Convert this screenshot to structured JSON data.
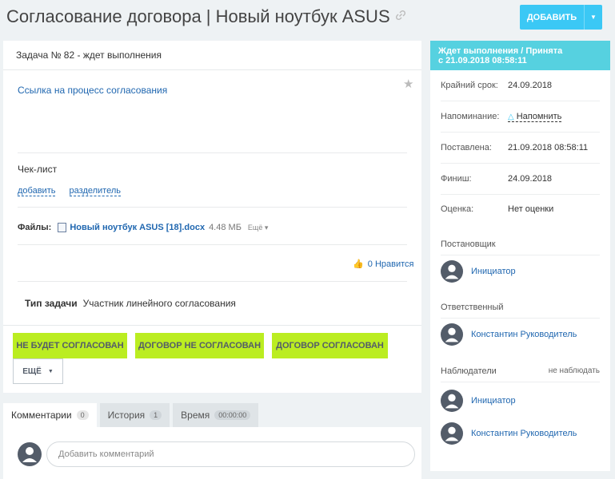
{
  "header": {
    "title": "Согласование договора | Новый ноутбук ASUS",
    "add_label": "ДОБАВИТЬ"
  },
  "task": {
    "heading": "Задача № 82 - ждет выполнения",
    "process_link": "Ссылка на процесс согласования",
    "checklist_label": "Чек-лист",
    "checklist_add": "добавить",
    "checklist_separator": "разделитель",
    "files_label": "Файлы:",
    "file_name": "Новый ноутбук ASUS [18].docx",
    "file_size": "4.48 МБ",
    "file_more": "Ещё",
    "like_count": "0",
    "like_label": "Нравится",
    "type_label": "Тип задачи",
    "type_value": "Участник линейного согласования"
  },
  "actions": {
    "not_approved": "НЕ БУДЕТ СОГЛАСОВАН",
    "contract_rejected": "ДОГОВОР НЕ СОГЛАСОВАН",
    "contract_approved": "ДОГОВОР СОГЛАСОВАН",
    "more": "ЕЩЁ"
  },
  "tabs": [
    {
      "label": "Комментарии",
      "count": "0"
    },
    {
      "label": "История",
      "count": "1"
    },
    {
      "label": "Время",
      "count": "00:00:00"
    }
  ],
  "comment": {
    "placeholder": "Добавить комментарий"
  },
  "sidebar": {
    "status_line1": "Ждет выполнения / Принята",
    "status_line2": "с 21.09.2018 08:58:11",
    "rows": [
      {
        "label": "Крайний срок:",
        "value": "24.09.2018"
      },
      {
        "label": "Напоминание:",
        "value": "Напомнить"
      },
      {
        "label": "Поставлена:",
        "value": "21.09.2018 08:58:11"
      },
      {
        "label": "Финиш:",
        "value": "24.09.2018"
      },
      {
        "label": "Оценка:",
        "value": "Нет оценки"
      }
    ],
    "creator_label": "Постановщик",
    "creator": "Инициатор",
    "responsible_label": "Ответственный",
    "responsible": "Константин Руководитель",
    "observers_label": "Наблюдатели",
    "observers_action": "не наблюдать",
    "observers": [
      "Инициатор",
      "Константин Руководитель"
    ]
  },
  "colors": {
    "accent": "#3bc8f5",
    "status_header": "#56d1e0",
    "action_green": "#bbed21",
    "link": "#2067b0"
  }
}
